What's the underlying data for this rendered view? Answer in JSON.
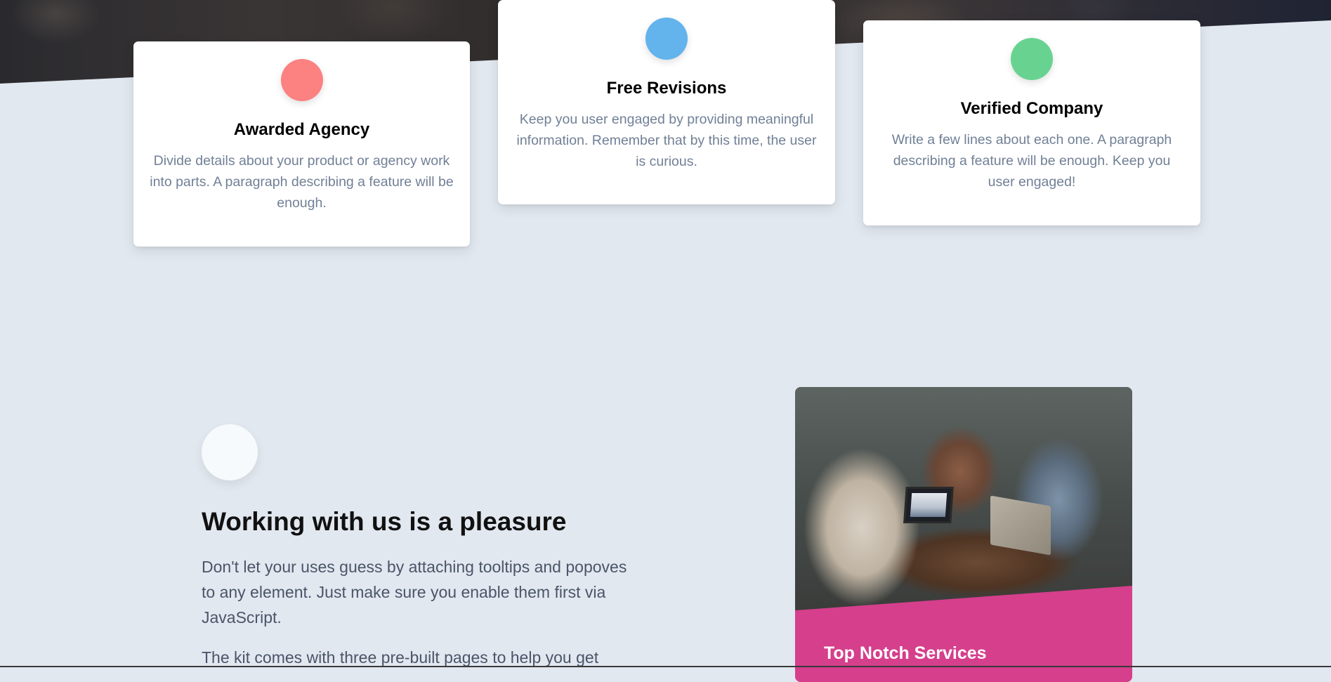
{
  "features": [
    {
      "title": "Awarded Agency",
      "description": "Divide details about your product or agency work into parts. A paragraph describing a feature will be enough.",
      "icon": "red-circle-icon",
      "color": "#fc8181"
    },
    {
      "title": "Free Revisions",
      "description": "Keep you user engaged by providing meaningful information. Remember that by this time, the user is curious.",
      "icon": "blue-circle-icon",
      "color": "#63b3ed"
    },
    {
      "title": "Verified Company",
      "description": "Write a few lines about each one. A paragraph describing a feature will be enough. Keep you user engaged!",
      "icon": "green-circle-icon",
      "color": "#68d391"
    }
  ],
  "working": {
    "icon": "white-circle-icon",
    "title": "Working with us is a pleasure",
    "paragraph_1": "Don't let your uses guess by attaching tooltips and popoves to any element. Just make sure you enable them first via JavaScript.",
    "paragraph_2": "The kit comes with three pre-built pages to help you get"
  },
  "image_card": {
    "title": "Top Notch Services",
    "accent_color": "#d53f8c"
  }
}
